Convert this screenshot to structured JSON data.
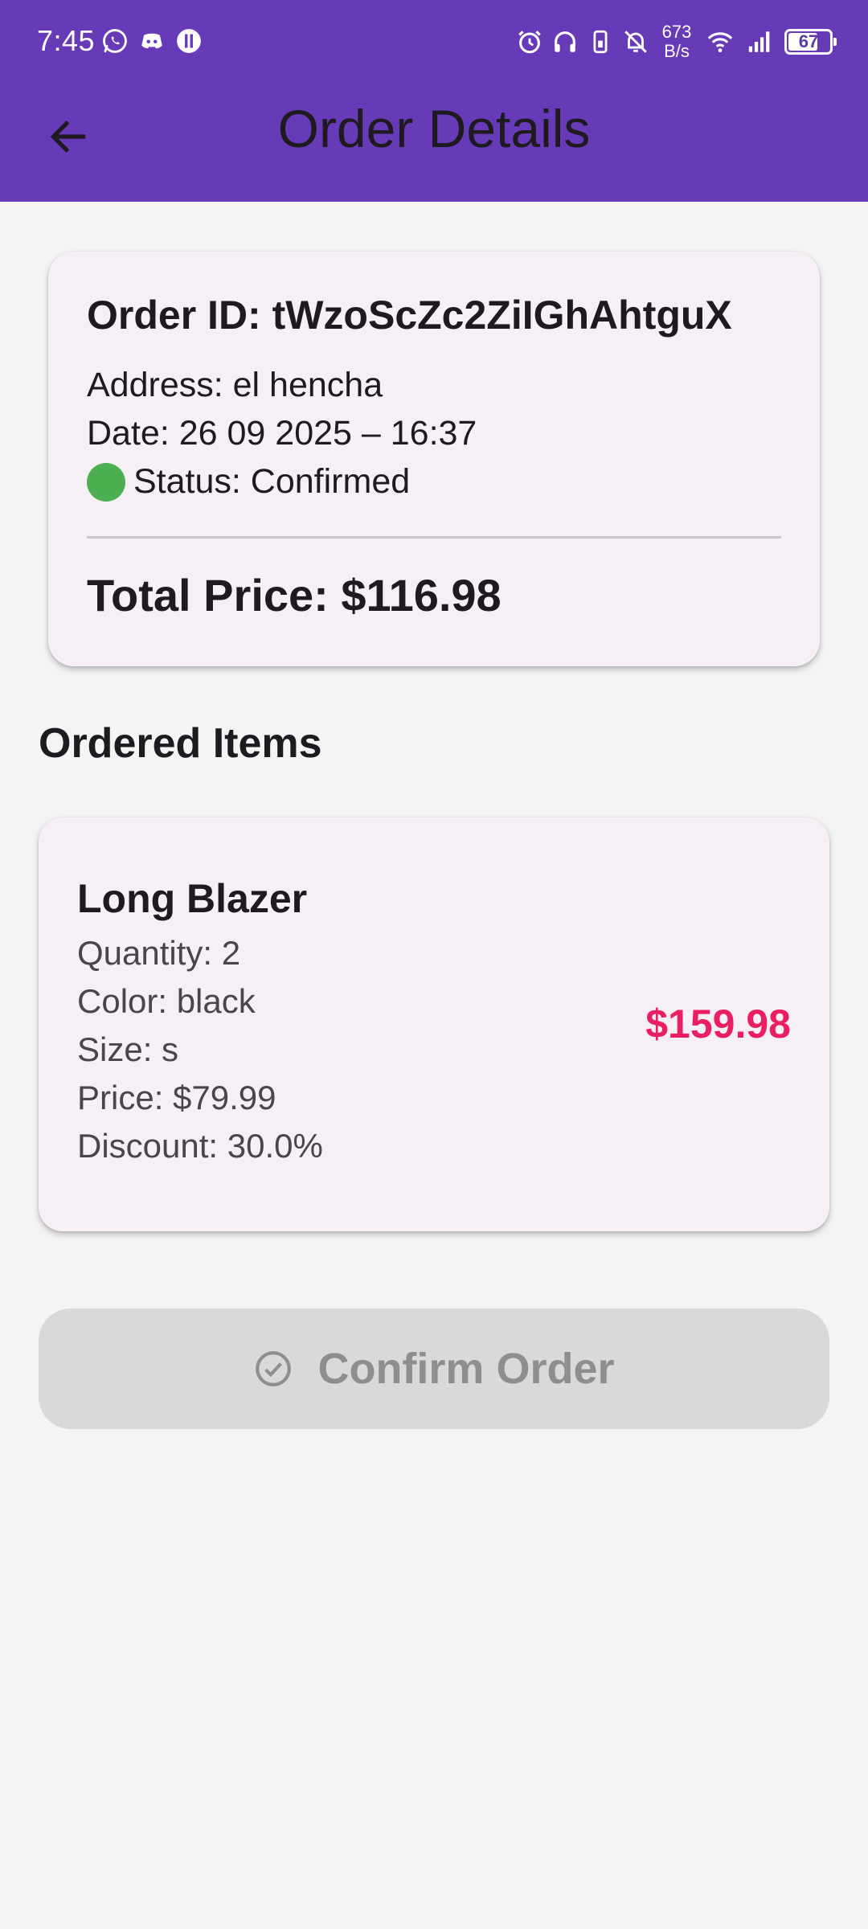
{
  "status_bar": {
    "time": "7:45",
    "net_speed_value": "673",
    "net_speed_unit": "B/s",
    "battery_level": "67"
  },
  "app_bar": {
    "title": "Order Details"
  },
  "order": {
    "id_text": "Order ID: tWzoScZc2ZiIGhAhtguX",
    "address_text": "Address: el hencha",
    "date_text": "Date: 26 09 2025 – 16:37",
    "status_text": "Status: Confirmed",
    "status_color": "#4caf50",
    "total_text": "Total Price: $116.98"
  },
  "ordered_items": {
    "section_title": "Ordered Items",
    "items": [
      {
        "name": "Long Blazer",
        "quantity_text": "Quantity: 2",
        "color_text": "Color: black",
        "size_text": "Size: s",
        "price_text": "Price: $79.99",
        "discount_text": "Discount: 30.0%",
        "line_total": "$159.98"
      }
    ]
  },
  "confirm_button": {
    "label": "Confirm Order",
    "icon": "check-circle-icon",
    "enabled": false
  },
  "colors": {
    "primary": "#673ab7",
    "accent_price": "#e91e63",
    "card_background": "#f6eff6",
    "page_background": "#f4f4f4",
    "disabled_button": "#d9d9d9"
  }
}
